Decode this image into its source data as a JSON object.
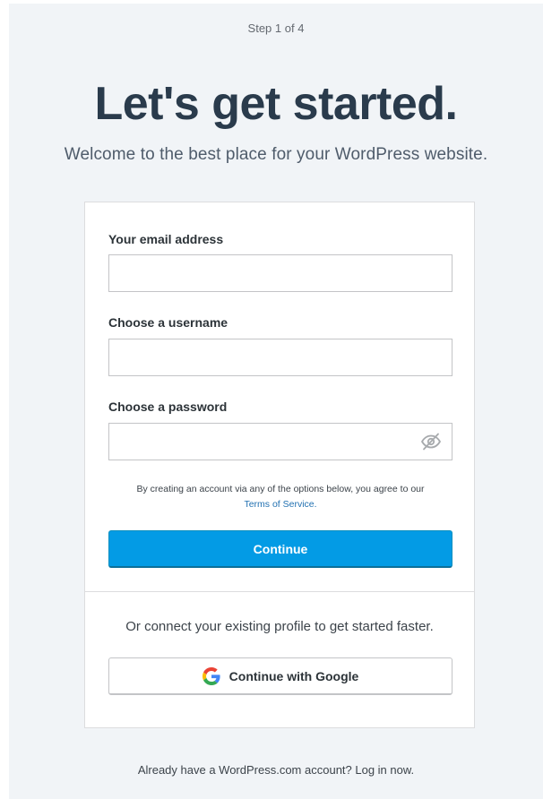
{
  "header": {
    "step": "Step 1 of 4",
    "title": "Let's get started.",
    "subtitle": "Welcome to the best place for your WordPress website."
  },
  "form": {
    "email": {
      "label": "Your email address",
      "value": "",
      "placeholder": ""
    },
    "username": {
      "label": "Choose a username",
      "value": "",
      "placeholder": ""
    },
    "password": {
      "label": "Choose a password",
      "value": "",
      "placeholder": "",
      "toggle_icon": "eye-slash-icon"
    },
    "terms_text": "By creating an account via any of the options below, you agree to our",
    "terms_link": "Terms of Service.",
    "continue_label": "Continue"
  },
  "social": {
    "text": "Or connect your existing profile to get started faster.",
    "google_label": "Continue with Google",
    "google_icon": "google-logo-icon"
  },
  "footer": {
    "text": "Already have a WordPress.com account? Log in now."
  },
  "colors": {
    "background": "#f1f4f7",
    "primary": "#039be5",
    "title": "#2a3b4c",
    "link": "#2271b1"
  }
}
